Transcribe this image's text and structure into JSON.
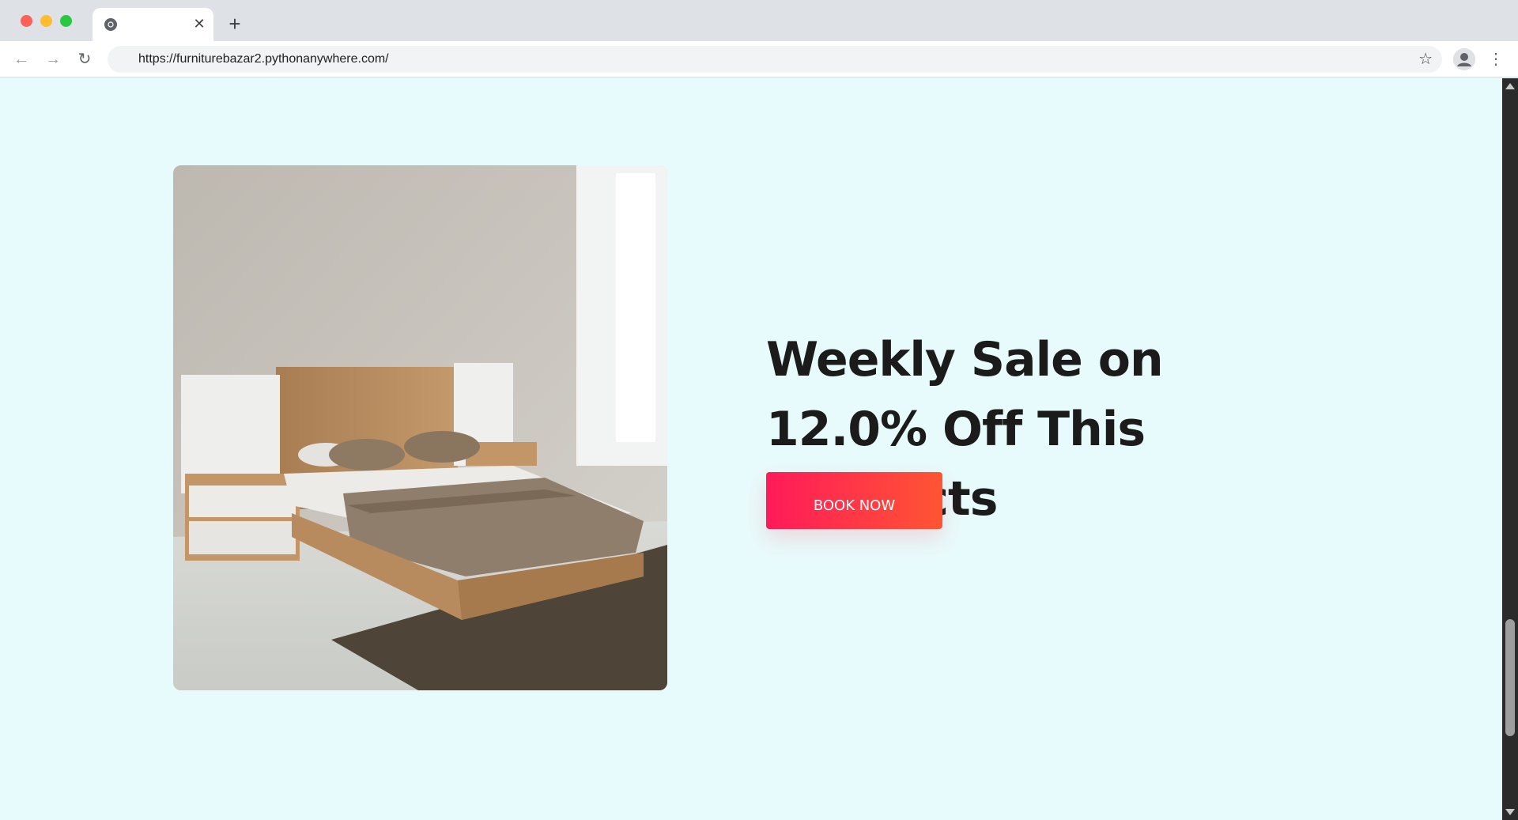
{
  "browser": {
    "tab": {
      "title": "",
      "favicon": "chrome-icon",
      "close_glyph": "✕"
    },
    "new_tab_glyph": "+",
    "url": "https://furniturebazar2.pythonanywhere.com/",
    "icons": {
      "back": "←",
      "forward": "→",
      "reload": "↻",
      "bookmark": "☆",
      "menu": "⋮"
    }
  },
  "page": {
    "background": "#e8fbfc",
    "hero": {
      "headline": "Weekly Sale on 12.0% Off This Products",
      "cta_label": "BOOK NOW",
      "cta_colors": {
        "start": "#ff1a5a",
        "end": "#ff5533"
      },
      "image": "bed-photo"
    }
  }
}
